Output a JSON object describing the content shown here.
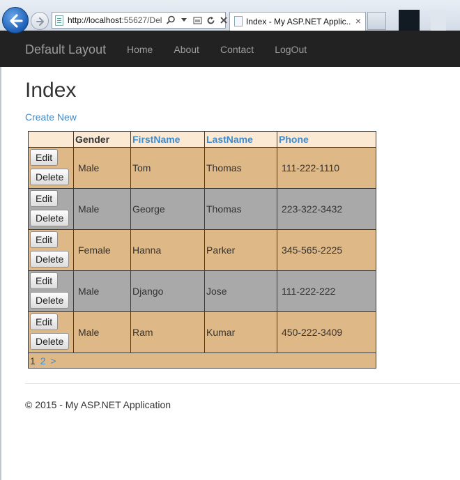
{
  "browser": {
    "address_host": "http://localhost",
    "address_rest": ":55627/Del",
    "tab_title": "Index - My ASP.NET Applic...",
    "tab_close": "×"
  },
  "navbar": {
    "brand": "Default Layout",
    "links": [
      "Home",
      "About",
      "Contact",
      "LogOut"
    ]
  },
  "page": {
    "title": "Index",
    "create_link": "Create New"
  },
  "grid": {
    "headers": [
      "",
      "Gender",
      "FirstName",
      "LastName",
      "Phone"
    ],
    "edit_label": "Edit",
    "delete_label": "Delete",
    "rows": [
      {
        "gender": "Male",
        "first": "Tom",
        "last": "Thomas",
        "phone": "111-222-1110"
      },
      {
        "gender": "Male",
        "first": "George",
        "last": "Thomas",
        "phone": "223-322-3432"
      },
      {
        "gender": "Female",
        "first": "Hanna",
        "last": "Parker",
        "phone": "345-565-2225"
      },
      {
        "gender": "Male",
        "first": "Django",
        "last": "Jose",
        "phone": "111-222-222"
      },
      {
        "gender": "Male",
        "first": "Ram",
        "last": "Kumar",
        "phone": "450-222-3409"
      }
    ],
    "pager": {
      "current": "1",
      "next_page": "2",
      "next": ">"
    },
    "colors": {
      "row_odd": "#deb887",
      "row_even": "#a9a9a9",
      "header": "#fbe9d4",
      "link": "#428bca"
    }
  },
  "footer": {
    "text": "© 2015 - My ASP.NET Application"
  }
}
